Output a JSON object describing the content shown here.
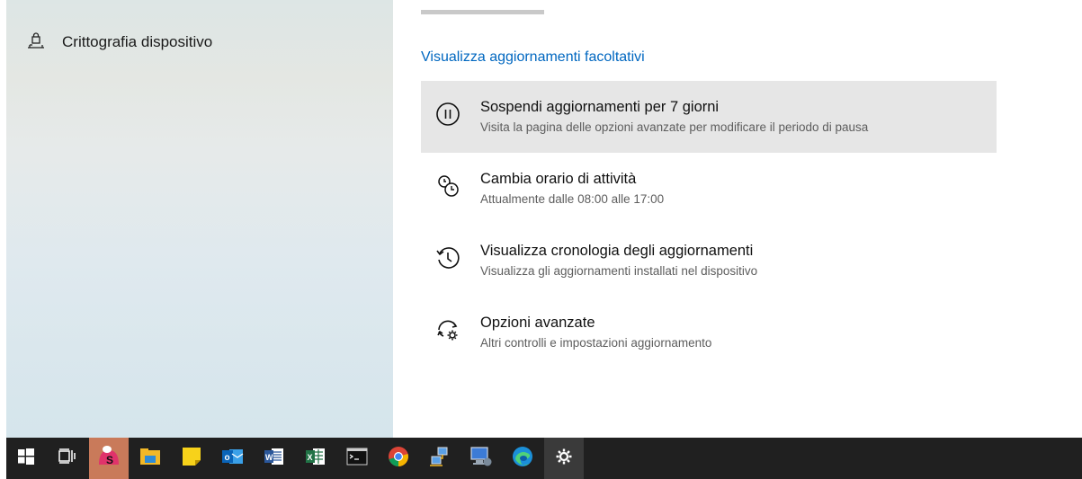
{
  "sidebar": {
    "items": [
      {
        "label": "Crittografia dispositivo",
        "icon": "laptop-lock-icon"
      }
    ]
  },
  "main": {
    "optional_updates_link": "Visualizza aggiornamenti facoltativi",
    "options": [
      {
        "title": "Sospendi aggiornamenti per 7 giorni",
        "subtitle": "Visita la pagina delle opzioni avanzate per modificare il periodo di pausa",
        "icon": "pause-icon",
        "highlighted": true
      },
      {
        "title": "Cambia orario di attività",
        "subtitle": "Attualmente dalle 08:00 alle 17:00",
        "icon": "active-hours-icon",
        "highlighted": false
      },
      {
        "title": "Visualizza cronologia degli aggiornamenti",
        "subtitle": "Visualizza gli aggiornamenti installati nel dispositivo",
        "icon": "history-icon",
        "highlighted": false
      },
      {
        "title": "Opzioni avanzate",
        "subtitle": "Altri controlli e impostazioni aggiornamento",
        "icon": "advanced-sync-gear-icon",
        "highlighted": false
      }
    ]
  },
  "taskbar": {
    "items": [
      {
        "name": "start-icon"
      },
      {
        "name": "task-view-icon"
      },
      {
        "name": "app-s-icon"
      },
      {
        "name": "file-explorer-icon"
      },
      {
        "name": "sticky-notes-icon"
      },
      {
        "name": "outlook-icon"
      },
      {
        "name": "word-icon"
      },
      {
        "name": "excel-icon"
      },
      {
        "name": "command-prompt-icon"
      },
      {
        "name": "chrome-icon"
      },
      {
        "name": "network-icon"
      },
      {
        "name": "computer-icon"
      },
      {
        "name": "edge-icon"
      },
      {
        "name": "settings-gear-icon",
        "active": true
      }
    ]
  },
  "colors": {
    "link": "#0067c0",
    "taskbar": "#202020",
    "highlight": "#e6e6e6"
  }
}
